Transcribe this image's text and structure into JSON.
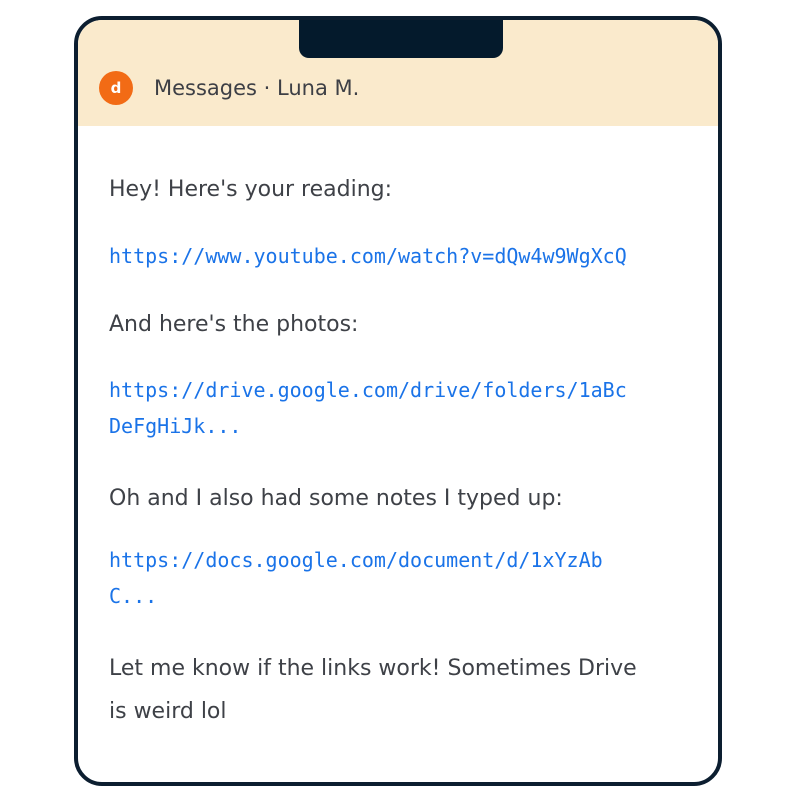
{
  "header": {
    "avatar_initial": "d",
    "title": "Messages · Luna M."
  },
  "messages": [
    {
      "type": "text",
      "text": "Hey! Here's your reading:"
    },
    {
      "type": "link",
      "lines": [
        "https://www.youtube.com/watch?v=dQw4w9WgXcQ"
      ]
    },
    {
      "type": "text",
      "text": "And here's the photos:"
    },
    {
      "type": "link",
      "lines": [
        "https://drive.google.com/drive/folders/1aBc",
        "DeFgHiJk..."
      ]
    },
    {
      "type": "text",
      "text": "Oh and I also had some notes I typed up:"
    },
    {
      "type": "link",
      "lines": [
        "https://docs.google.com/document/d/1xYzAb",
        "C..."
      ]
    },
    {
      "type": "text",
      "lines": [
        "Let me know if the links work! Sometimes Drive",
        "is weird lol"
      ]
    }
  ],
  "colors": {
    "header_bg": "#faeacc",
    "avatar_bg": "#f26b15",
    "frame": "#0c1e30",
    "link": "#1a73e8",
    "text": "#3e4147"
  }
}
